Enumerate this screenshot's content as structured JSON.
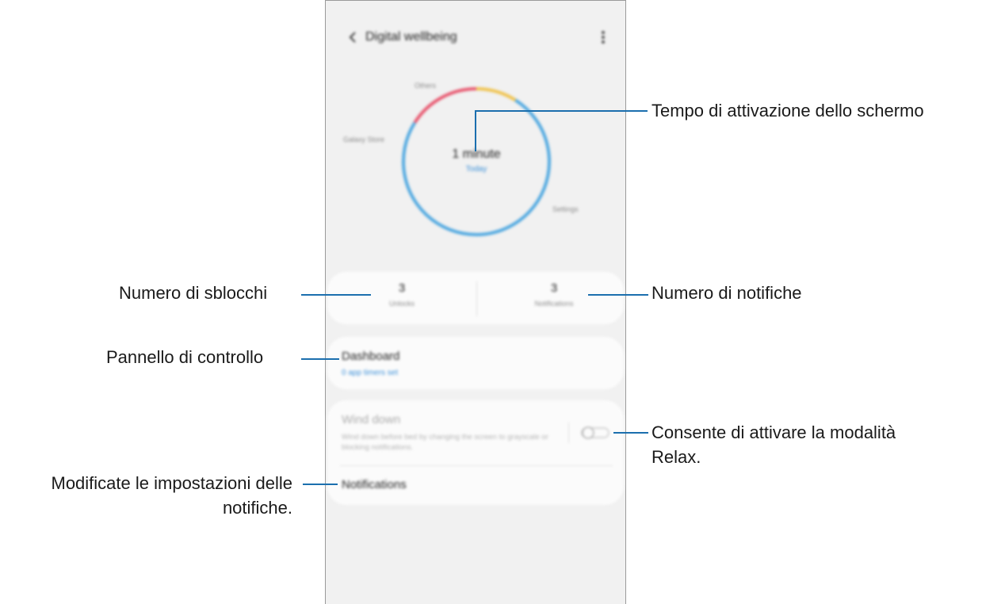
{
  "phone": {
    "app_title": "Digital wellbeing",
    "donut": {
      "value_text": "1 minute",
      "sub_text": "Today",
      "segments": [
        {
          "label": "Others",
          "color": "#f0c34e",
          "fraction": 0.09
        },
        {
          "label": "Galaxy Store",
          "color": "#e8576f",
          "fraction": 0.16
        },
        {
          "label": "Settings",
          "color": "#4fa8e0",
          "fraction": 0.75
        }
      ]
    },
    "stats": {
      "unlocks": {
        "value": "3",
        "label": "Unlocks"
      },
      "notifications": {
        "value": "3",
        "label": "Notifications"
      }
    },
    "dashboard": {
      "title": "Dashboard",
      "subtitle": "0 app timers set"
    },
    "wind_down": {
      "title": "Wind down",
      "description": "Wind down before bed by changing the screen to grayscale or blocking notifications.",
      "toggle_on": false
    },
    "notifications_label": "Notifications"
  },
  "callouts": {
    "screen_time": "Tempo di attivazione dello schermo",
    "unlocks": "Numero di sblocchi",
    "notifications": "Numero di notifiche",
    "dashboard": "Pannello di controllo",
    "wind_down": [
      "Consente di attivare la modalità",
      "Relax."
    ],
    "notification_settings": [
      "Modificate le impostazioni delle",
      "notifiche."
    ]
  },
  "colors": {
    "callout_line": "#1b6fae",
    "accent_blue": "#3a8fd8"
  },
  "chart_data": {
    "type": "pie",
    "categories": [
      "Others",
      "Galaxy Store",
      "Settings"
    ],
    "values": [
      0.09,
      0.16,
      0.75
    ],
    "title": "1 minute",
    "subtitle": "Today"
  }
}
